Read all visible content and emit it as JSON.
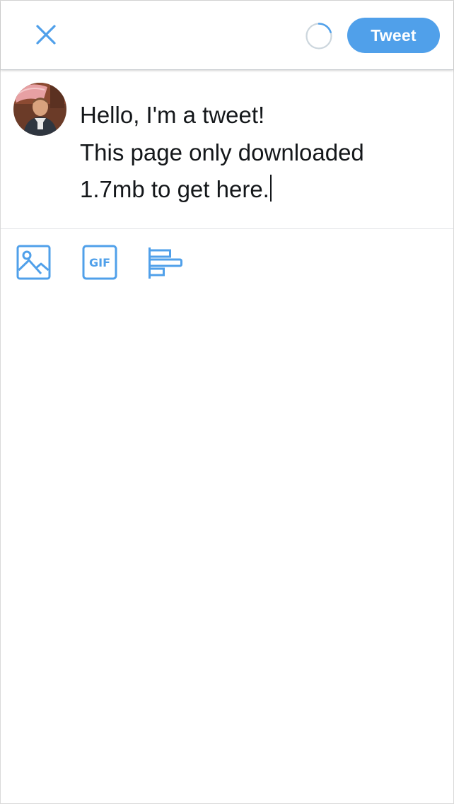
{
  "header": {
    "close_icon": "close-icon",
    "progress_icon": "character-count-ring",
    "tweet_label": "Tweet"
  },
  "compose": {
    "avatar_icon": "user-avatar",
    "lines": [
      "Hello, I'm a tweet!",
      "This page only downloaded",
      "1.7mb to get here."
    ]
  },
  "toolbar": {
    "image_icon": "image-icon",
    "gif_label": "GIF",
    "poll_icon": "poll-icon"
  },
  "colors": {
    "accent": "#50a0ea",
    "text": "#14171a",
    "divider": "#e3e5e8"
  }
}
